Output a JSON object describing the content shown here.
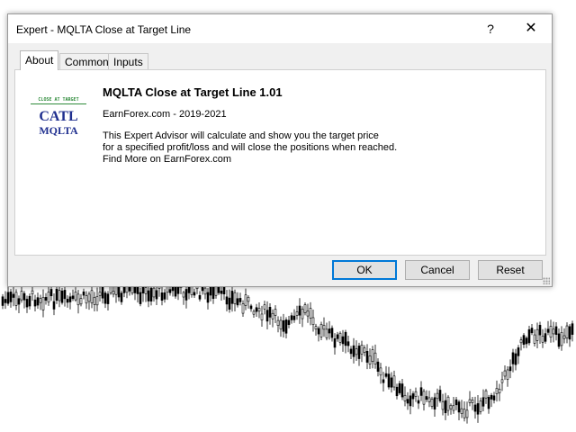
{
  "dialog": {
    "title": "Expert - MQLTA Close at Target Line",
    "help_glyph": "?",
    "close_glyph": "✕"
  },
  "tabs": [
    {
      "label": "About",
      "active": true
    },
    {
      "label": "Common",
      "active": false
    },
    {
      "label": "Inputs",
      "active": false
    }
  ],
  "about": {
    "logo": {
      "small_text": "CLOSE AT TARGET",
      "big_text": "CATL",
      "sub_text": "MQLTA"
    },
    "name": "MQLTA Close at Target Line 1.01",
    "copyright": "EarnForex.com - 2019-2021",
    "description_lines": [
      "This Expert Advisor will calculate and show you the target price",
      "for a specified profit/loss and will close the positions when reached.",
      "Find More on EarnForex.com"
    ]
  },
  "buttons": {
    "ok": "OK",
    "cancel": "Cancel",
    "reset": "Reset"
  },
  "colors": {
    "accent": "#0078d7",
    "logo_blue": "#1f2f8f",
    "logo_green": "#2e8b3a",
    "candle": "#000000"
  }
}
